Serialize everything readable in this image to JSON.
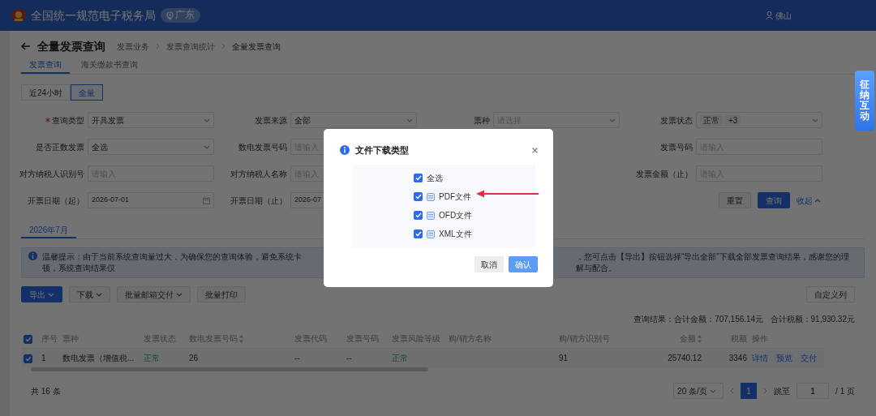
{
  "header": {
    "title": "全国统一规范电子税务局",
    "region": "广东",
    "user": "佛山"
  },
  "page": {
    "title": "全量发票查询",
    "breadcrumb": [
      "发票业务",
      "发票查询统计",
      "全量发票查询"
    ]
  },
  "tabs": [
    {
      "label": "发票查询",
      "selected": true
    },
    {
      "label": "海关缴款书查询",
      "selected": false
    }
  ],
  "time_range": [
    {
      "label": "近24小时",
      "selected": false
    },
    {
      "label": "全量",
      "selected": true
    }
  ],
  "filters": [
    [
      {
        "label": "查询类型",
        "required": true,
        "kind": "select",
        "value": "开具发票"
      },
      {
        "label": "发票来源",
        "required": false,
        "kind": "select",
        "value": "全部"
      },
      {
        "label": "票种",
        "required": false,
        "kind": "select",
        "placeholder": "请选择"
      },
      {
        "label": "发票状态",
        "required": false,
        "kind": "tags",
        "tags": [
          "正常",
          "+3"
        ]
      }
    ],
    [
      {
        "label": "是否正数发票",
        "required": false,
        "kind": "select",
        "value": "全选"
      },
      {
        "label": "数电发票号码",
        "required": false,
        "kind": "input",
        "placeholder": "请输入"
      },
      {
        "label": "发票号码",
        "required": false,
        "kind": "input",
        "placeholder": "请输入"
      }
    ],
    [
      {
        "label": "对方纳税人识别号",
        "required": false,
        "kind": "input",
        "placeholder": "请输入"
      },
      {
        "label": "对方纳税人名称",
        "required": false,
        "kind": "input",
        "placeholder": "请输入"
      },
      {
        "label": "发票金额（止）",
        "required": false,
        "kind": "input",
        "placeholder": "请输入"
      }
    ],
    [
      {
        "label": "开票日期（起）",
        "required": false,
        "kind": "date",
        "value": "2026-07-01",
        "calendar_icon": true
      },
      {
        "label": "开票日期（止）",
        "required": false,
        "kind": "date",
        "value": "2026-07",
        "calendar_icon": false
      }
    ]
  ],
  "filter_actions": {
    "reset": "重置",
    "query": "查询",
    "collapse": "收起"
  },
  "month_tabs": [
    {
      "label": "2026年7月",
      "selected": true
    }
  ],
  "notice": {
    "text_before": "温馨提示：由于当前系统查询量过大，为确保您的查询体验，避免系统卡顿，系统查询结果仅",
    "text_after": "，您可点击【导出】按钮选择“导出全部”下载全部发票查询结果，感谢您的理解与配合。"
  },
  "toolbar": {
    "buttons": [
      {
        "label": "导出",
        "kind": "primary",
        "dropdown": true
      },
      {
        "label": "下载",
        "kind": "default",
        "dropdown": true
      },
      {
        "label": "批量邮箱交付",
        "kind": "default",
        "dropdown": true
      },
      {
        "label": "批量打印",
        "kind": "default",
        "dropdown": false
      }
    ],
    "customize": "自定义列"
  },
  "summary": "查询结果：合计金额：707,156.14元   合计税额：91,930.32元",
  "table": {
    "all_checked": true,
    "columns": [
      {
        "label": "序号",
        "sortable": false
      },
      {
        "label": "票种",
        "sortable": false
      },
      {
        "label": "发票状态",
        "sortable": false
      },
      {
        "label": "数电发票号码",
        "sortable": true
      },
      {
        "label": "发票代码",
        "sortable": false
      },
      {
        "label": "发票号码",
        "sortable": false
      },
      {
        "label": "发票风险等级",
        "sortable": false
      },
      {
        "label": "购/销方名称",
        "sortable": false
      },
      {
        "label": "购/销方识别号",
        "sortable": false
      },
      {
        "label": "金额",
        "sortable": true
      },
      {
        "label": "税额",
        "sortable": false
      },
      {
        "label": "操作",
        "sortable": false
      }
    ],
    "rows": [
      {
        "selected": true,
        "cells": [
          {
            "text": "1",
            "kind": "plain"
          },
          {
            "text": "数电发票（增值税...",
            "kind": "plain"
          },
          {
            "text": "正常",
            "kind": "status"
          },
          {
            "text": "26",
            "kind": "plain"
          },
          {
            "text": "--",
            "kind": "plain"
          },
          {
            "text": "--",
            "kind": "plain"
          },
          {
            "text": "正常",
            "kind": "status"
          },
          null,
          {
            "text": "91",
            "kind": "plain"
          },
          {
            "text": "25740.12",
            "kind": "number"
          },
          {
            "text": "3346",
            "kind": "number"
          }
        ],
        "actions": [
          "详情",
          "预览",
          "交付"
        ]
      }
    ]
  },
  "pagination": {
    "total": "共 16 条",
    "page_size": "20 条/页",
    "pages": [
      {
        "label": "1",
        "selected": true
      }
    ],
    "jump_label": "跳至",
    "jump_value": "1",
    "page_count": "/ 1 页"
  },
  "float_button": "征纳互动",
  "modal": {
    "title": "文件下载类型",
    "options": [
      {
        "label": "全选",
        "kind": "select_all",
        "checked": true,
        "annotated": false
      },
      {
        "label": "PDF文件",
        "kind": "file",
        "checked": true,
        "annotated": true
      },
      {
        "label": "OFD文件",
        "kind": "file",
        "checked": true,
        "annotated": false
      },
      {
        "label": "XML文件",
        "kind": "file",
        "checked": true,
        "annotated": false
      }
    ],
    "buttons": [
      {
        "label": "取消",
        "kind": "secondary"
      },
      {
        "label": "确认",
        "kind": "primary"
      }
    ]
  }
}
